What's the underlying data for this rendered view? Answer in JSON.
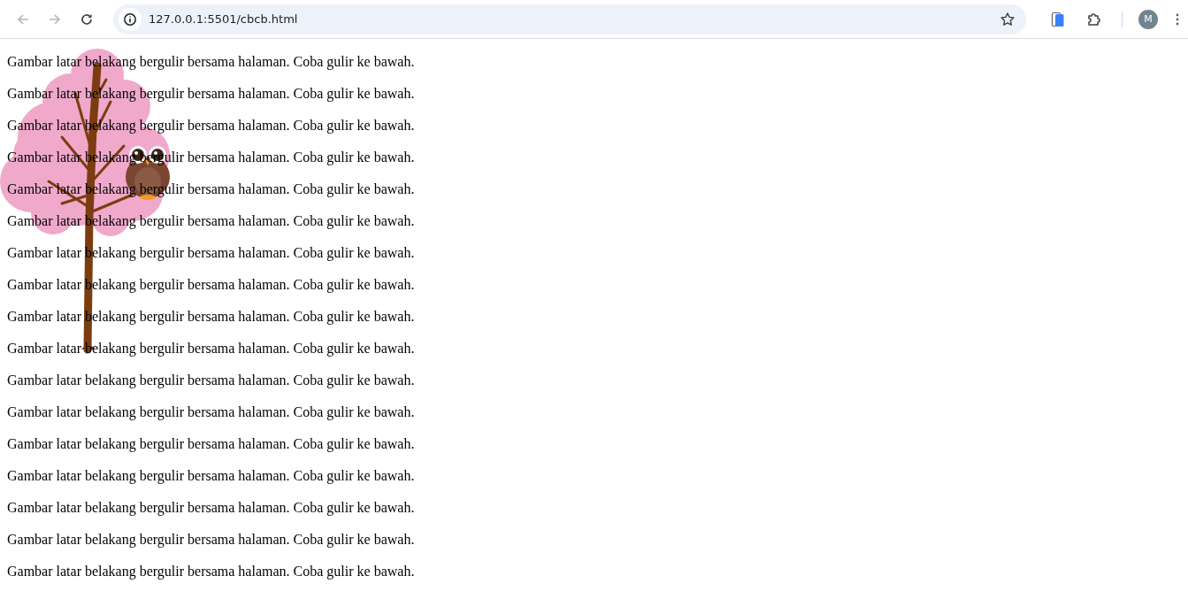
{
  "browser": {
    "back": {
      "disabled": true
    },
    "forward": {
      "disabled": true
    },
    "url": "127.0.0.1:5501/cbcb.html",
    "profile_initial": "M"
  },
  "paragraphs": [
    "Gambar latar belakang bergulir bersama halaman. Coba gulir ke bawah.",
    "Gambar latar belakang bergulir bersama halaman. Coba gulir ke bawah.",
    "Gambar latar belakang bergulir bersama halaman. Coba gulir ke bawah.",
    "Gambar latar belakang bergulir bersama halaman. Coba gulir ke bawah.",
    "Gambar latar belakang bergulir bersama halaman. Coba gulir ke bawah.",
    "Gambar latar belakang bergulir bersama halaman. Coba gulir ke bawah.",
    "Gambar latar belakang bergulir bersama halaman. Coba gulir ke bawah.",
    "Gambar latar belakang bergulir bersama halaman. Coba gulir ke bawah.",
    "Gambar latar belakang bergulir bersama halaman. Coba gulir ke bawah.",
    "Gambar latar belakang bergulir bersama halaman. Coba gulir ke bawah.",
    "Gambar latar belakang bergulir bersama halaman. Coba gulir ke bawah.",
    "Gambar latar belakang bergulir bersama halaman. Coba gulir ke bawah.",
    "Gambar latar belakang bergulir bersama halaman. Coba gulir ke bawah.",
    "Gambar latar belakang bergulir bersama halaman. Coba gulir ke bawah.",
    "Gambar latar belakang bergulir bersama halaman. Coba gulir ke bawah.",
    "Gambar latar belakang bergulir bersama halaman. Coba gulir ke bawah.",
    "Gambar latar belakang bergulir bersama halaman. Coba gulir ke bawah."
  ]
}
